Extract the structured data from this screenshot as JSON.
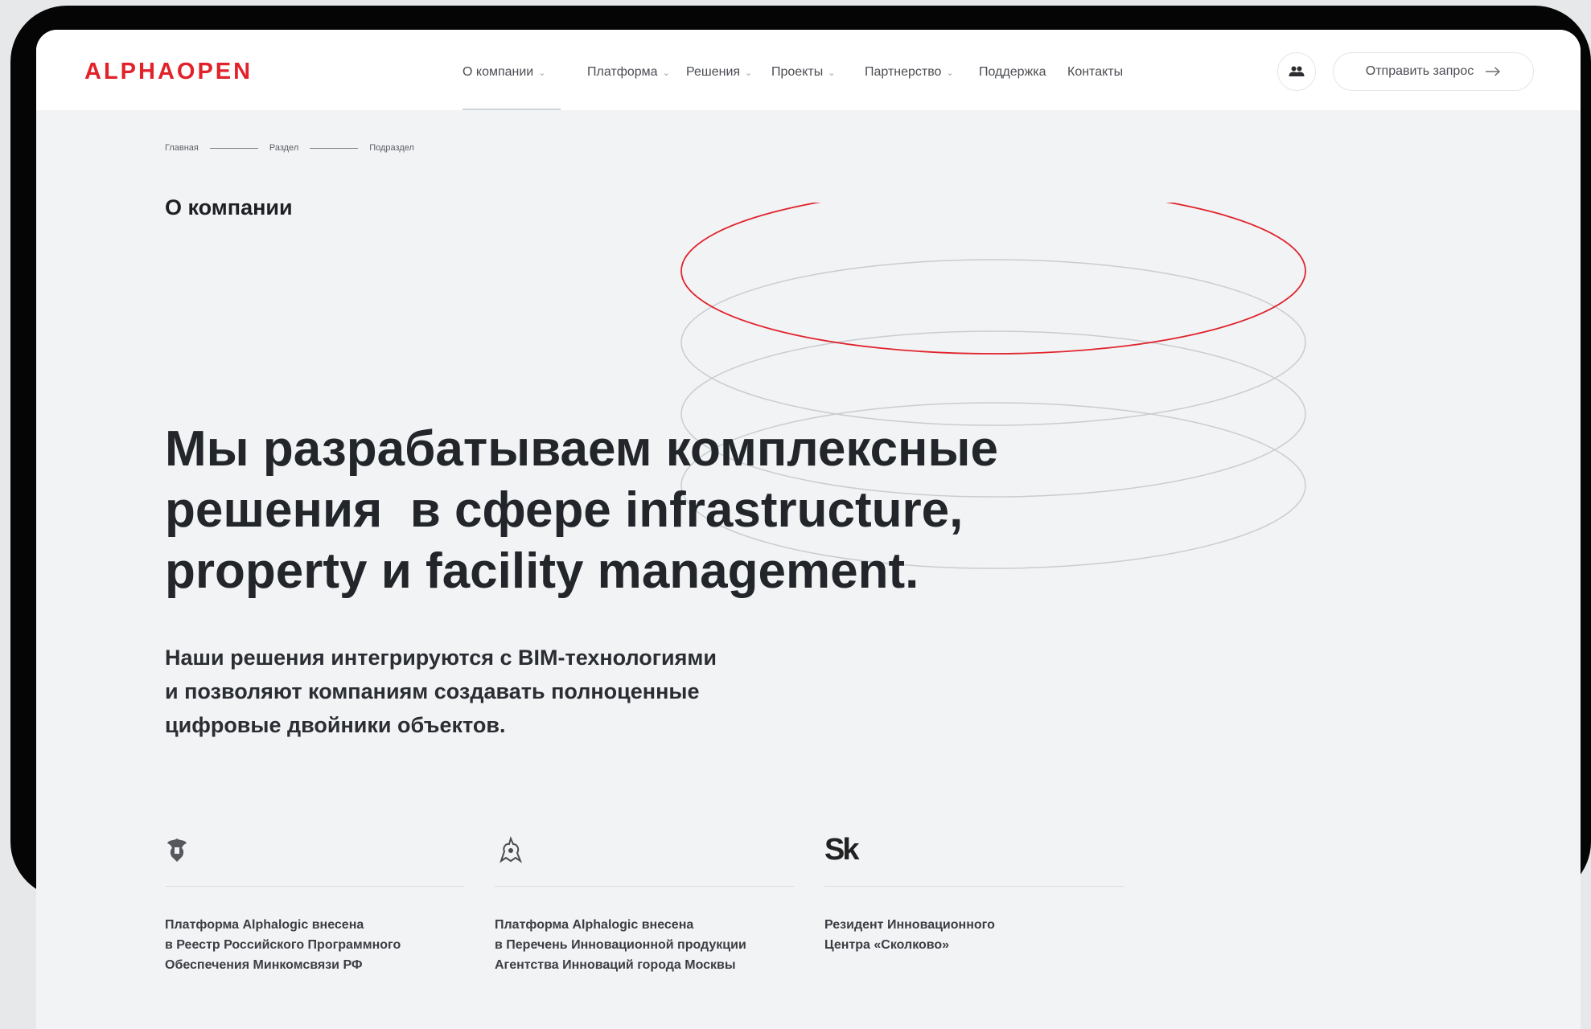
{
  "header": {
    "logo": "ALPHAOPEN",
    "nav": [
      {
        "label": "О компании",
        "has_dropdown": true,
        "active": true
      },
      {
        "label": "Платформа",
        "has_dropdown": true
      },
      {
        "label": "Решения",
        "has_dropdown": true
      },
      {
        "label": "Проекты",
        "has_dropdown": true
      },
      {
        "label": "Партнерство",
        "has_dropdown": true
      },
      {
        "label": "Поддержка",
        "has_dropdown": false
      },
      {
        "label": "Контакты",
        "has_dropdown": false
      }
    ],
    "user_icon": "users-icon",
    "request_button": "Отправить запрос",
    "request_icon": "arrow-right-icon"
  },
  "breadcrumb": [
    "Главная",
    "Раздел",
    "Подраздел"
  ],
  "page_title": "О компании",
  "hero": {
    "headline": "Мы разрабатываем комплексные\nрешения  в сфере infrastructure,\nproperty и facility management.",
    "lead": "Наши решения интегрируются с BIM-технологиями\nи позволяют компаниям создавать полноценные\nцифровые двойники объектов."
  },
  "badges": [
    {
      "icon": "russian-emblem-icon",
      "text": "Платформа Alphalogic внесена\nв Реестр Российского Программного\nОбеспечения Минкомсвязи РФ"
    },
    {
      "icon": "moscow-emblem-icon",
      "text": "Платформа Alphalogic внесена\nв Перечень Инновационной продукции\nАгентства Инноваций города Москвы"
    },
    {
      "icon": "skolkovo-logo-icon",
      "logo_text": "Sk",
      "text": "Резидент Инновационного\nЦентра «Сколково»"
    }
  ],
  "colors": {
    "brand": "#e0232b",
    "frame": "#050505",
    "page_bg": "#f2f3f5",
    "ring_accent": "#e0232b",
    "ring_muted": "#c9ccd0"
  }
}
